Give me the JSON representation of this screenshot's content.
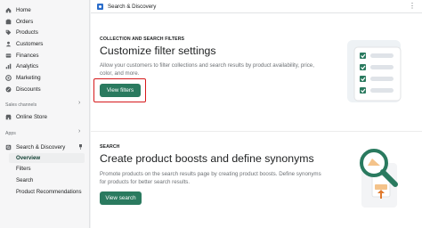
{
  "sidebar": {
    "items": [
      {
        "label": "Home",
        "icon": "home-icon"
      },
      {
        "label": "Orders",
        "icon": "orders-icon"
      },
      {
        "label": "Products",
        "icon": "tag-icon"
      },
      {
        "label": "Customers",
        "icon": "person-icon"
      },
      {
        "label": "Finances",
        "icon": "finances-icon"
      },
      {
        "label": "Analytics",
        "icon": "analytics-icon"
      },
      {
        "label": "Marketing",
        "icon": "marketing-icon"
      },
      {
        "label": "Discounts",
        "icon": "discount-icon"
      }
    ],
    "sales_channels_label": "Sales channels",
    "online_store": "Online Store",
    "apps_label": "Apps",
    "app_name": "Search & Discovery",
    "sub_items": [
      "Overview",
      "Filters",
      "Search",
      "Product Recommendations"
    ]
  },
  "topbar": {
    "title": "Search & Discovery",
    "more": "⋮"
  },
  "filters_card": {
    "label": "COLLECTION AND SEARCH FILTERS",
    "title": "Customize filter settings",
    "description": "Allow your customers to filter collections and search results by product availability, price, color, and more.",
    "button": "View filters"
  },
  "search_card": {
    "label": "SEARCH",
    "title": "Create product boosts and define synonyms",
    "description": "Promote products on the search results page by creating product boosts. Define synonyms for products for better search results.",
    "button": "View search"
  },
  "colors": {
    "primary_button": "#2a7a5f",
    "highlight": "#d6191b",
    "illustration_green": "#2a7a5f"
  }
}
